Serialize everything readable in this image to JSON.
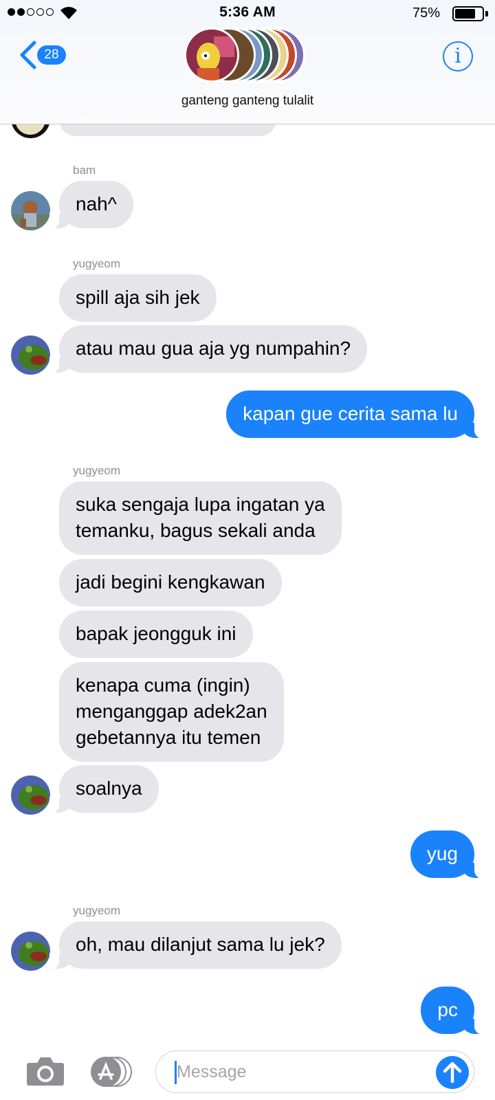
{
  "status_bar": {
    "time": "5:36 AM",
    "battery": "75%",
    "battery_level": 0.75,
    "signal_bars": 2
  },
  "header": {
    "back_count": "28",
    "group_name": "ganteng ganteng tulalit"
  },
  "thread": {
    "messages": [
      {
        "sender": "bam",
        "text": "nah^"
      },
      {
        "sender": "yugyeom",
        "text": "spill aja sih jek"
      },
      {
        "text": "atau mau gua aja yg numpahin?"
      },
      {
        "text": "kapan gue cerita sama lu"
      },
      {
        "sender": "yugyeom",
        "text_lines": [
          "suka sengaja lupa ingatan ya",
          "temanku, bagus sekali anda"
        ]
      },
      {
        "text": "jadi begini kengkawan"
      },
      {
        "text": "bapak jeongguk ini"
      },
      {
        "text_lines": [
          "kenapa cuma (ingin)",
          "menganggap adek2an",
          "gebetannya itu temen"
        ]
      },
      {
        "text": "soalnya"
      },
      {
        "text": "yug"
      },
      {
        "sender": "yugyeom",
        "text": "oh, mau dilanjut sama lu jek?"
      },
      {
        "text": "pc"
      }
    ]
  },
  "composer": {
    "placeholder": "Message"
  },
  "colors": {
    "accent": "#1a82fb",
    "incoming_bubble": "#e5e5ea",
    "sender_label": "#8e8e93"
  }
}
